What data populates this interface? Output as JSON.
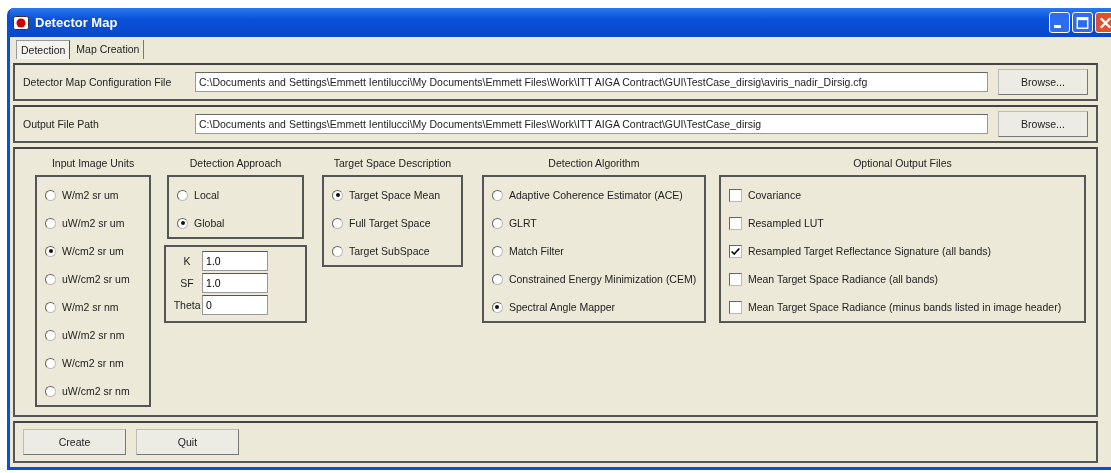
{
  "window": {
    "title": "Detector Map"
  },
  "tabs": [
    {
      "label": "Detection",
      "selected": true
    },
    {
      "label": "Map Creation",
      "selected": false
    }
  ],
  "config_file": {
    "label": "Detector Map Configuration File",
    "value": "C:\\Documents and Settings\\Emmett Ientilucci\\My Documents\\Emmett Files\\Work\\ITT AIGA Contract\\GUI\\TestCase_dirsig\\aviris_nadir_Dirsig.cfg",
    "button": "Browse..."
  },
  "output_path": {
    "label": "Output File Path",
    "value": "C:\\Documents and Settings\\Emmett Ientilucci\\My Documents\\Emmett Files\\Work\\ITT AIGA Contract\\GUI\\TestCase_dirsig",
    "button": "Browse..."
  },
  "input_image_units": {
    "title": "Input Image Units",
    "options": [
      {
        "label": "W/m2 sr um",
        "selected": false
      },
      {
        "label": "uW/m2 sr um",
        "selected": false
      },
      {
        "label": "W/cm2 sr um",
        "selected": true
      },
      {
        "label": "uW/cm2 sr um",
        "selected": false
      },
      {
        "label": "W/m2 sr nm",
        "selected": false
      },
      {
        "label": "uW/m2 sr nm",
        "selected": false
      },
      {
        "label": "W/cm2 sr nm",
        "selected": false
      },
      {
        "label": "uW/cm2 sr nm",
        "selected": false
      }
    ]
  },
  "detection_approach": {
    "title": "Detection Approach",
    "options": [
      {
        "label": "Local",
        "selected": false
      },
      {
        "label": "Global",
        "selected": true
      }
    ]
  },
  "parameters": [
    {
      "label": "K",
      "value": "1.0"
    },
    {
      "label": "SF",
      "value": "1.0"
    },
    {
      "label": "Theta",
      "value": "0"
    }
  ],
  "target_space_description": {
    "title": "Target Space Description",
    "options": [
      {
        "label": "Target Space Mean",
        "selected": true
      },
      {
        "label": "Full Target Space",
        "selected": false
      },
      {
        "label": "Target SubSpace",
        "selected": false
      }
    ]
  },
  "detection_algorithm": {
    "title": "Detection Algorithm",
    "options": [
      {
        "label": "Adaptive Coherence Estimator (ACE)",
        "selected": false
      },
      {
        "label": "GLRT",
        "selected": false
      },
      {
        "label": "Match Filter",
        "selected": false
      },
      {
        "label": "Constrained Energy Minimization (CEM)",
        "selected": false
      },
      {
        "label": "Spectral Angle Mapper",
        "selected": true
      }
    ]
  },
  "optional_output_files": {
    "title": "Optional Output Files",
    "options": [
      {
        "label": "Covariance",
        "checked": false
      },
      {
        "label": "Resampled LUT",
        "checked": false
      },
      {
        "label": "Resampled Target Reflectance Signature (all bands)",
        "checked": true
      },
      {
        "label": "Mean Target Space Radiance (all bands)",
        "checked": false
      },
      {
        "label": "Mean Target Space Radiance (minus bands listed in image header)",
        "checked": false
      }
    ]
  },
  "buttons": [
    "Create",
    "Quit"
  ]
}
